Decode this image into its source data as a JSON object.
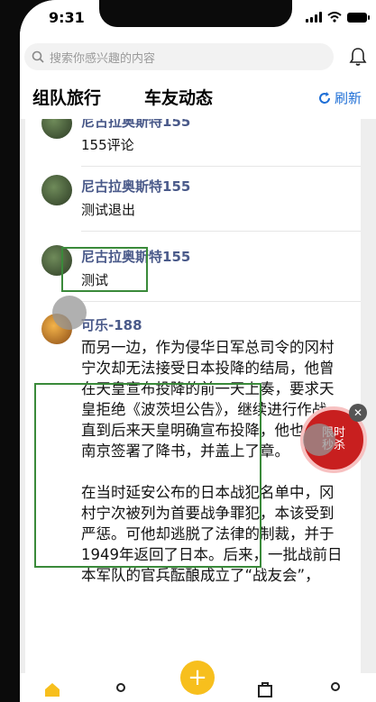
{
  "status": {
    "time": "9:31"
  },
  "search": {
    "placeholder": "搜索你感兴趣的内容"
  },
  "tabs": {
    "items": [
      "组队旅行",
      "车友动态"
    ],
    "refresh": "刷新"
  },
  "comments": [
    {
      "name": "尼古拉奥斯特155",
      "text": "155评论"
    },
    {
      "name": "尼古拉奥斯特155",
      "text": "测试退出"
    },
    {
      "name": "尼古拉奥斯特155",
      "text": "测试"
    },
    {
      "name": "可乐-188"
    }
  ],
  "article": {
    "paragraph1": "而另一边，作为侵华日军总司令的冈村宁次却无法接受日本投降的结局，他曾在天皇宣布投降的前一天上奏，要求天皇拒绝《波茨坦公告》，继续进行作战。直到后来天皇明确宣布投降，他也才在南京签署了降书，并盖上了章。",
    "paragraph2": "在当时延安公布的日本战犯名单中，冈村宁次被列为首要战争罪犯，本该受到严惩。可他却逃脱了法律的制裁，并于1949年返回了日本。后来，一批战前日本军队的官兵酝酿成立了“战友会”，"
  },
  "flash": {
    "line1": "限时",
    "line2": "秒杀"
  },
  "colors": {
    "accent": "#ffcc00",
    "link": "#1f6fd6",
    "name": "#4a5a8a"
  }
}
